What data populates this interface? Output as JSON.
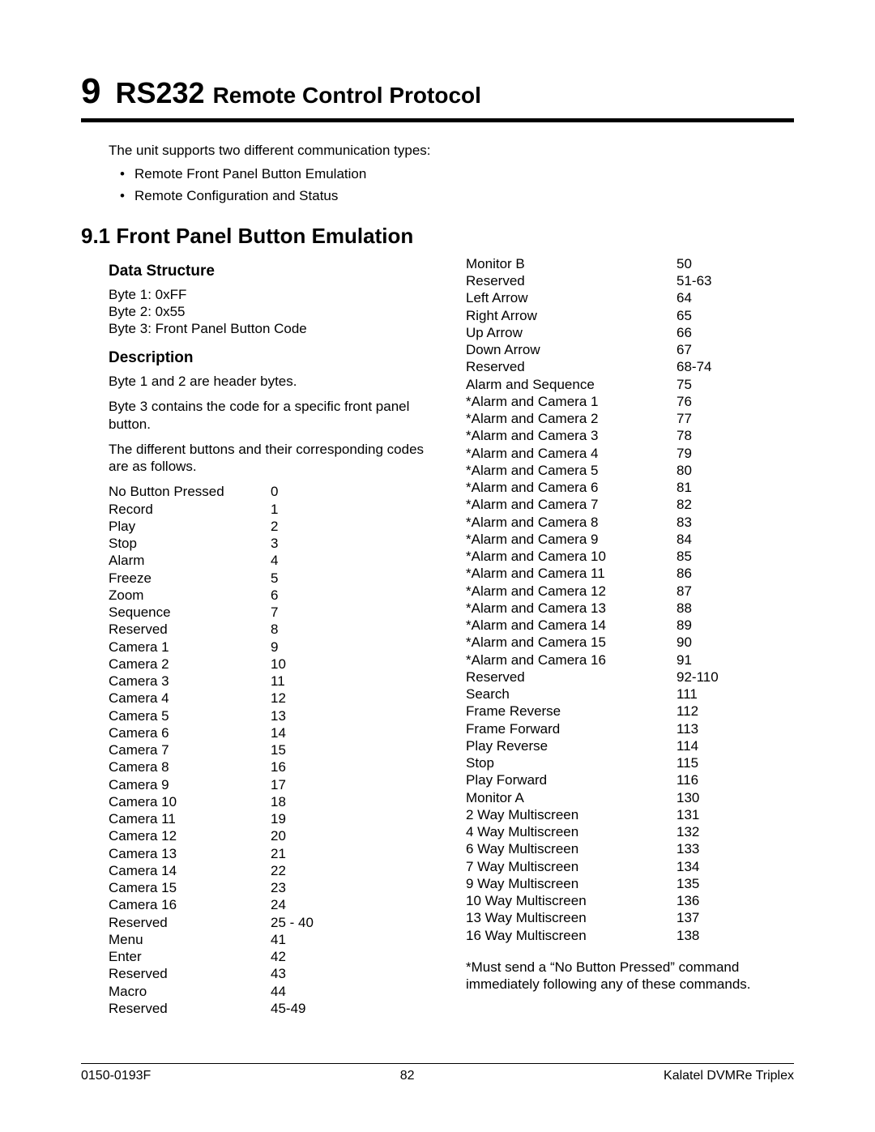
{
  "chapter": {
    "number": "9",
    "title_strong": "RS232",
    "title_rest": "Remote Control Protocol"
  },
  "intro": {
    "lead": "The unit supports two different communication types:",
    "bullets": [
      "Remote Front Panel Button Emulation",
      "Remote Configuration and Status"
    ]
  },
  "section": {
    "number_title": "9.1  Front Panel Button Emulation"
  },
  "left": {
    "data_structure_head": "Data Structure",
    "bytes": [
      "Byte 1:  0xFF",
      "Byte 2:  0x55",
      "Byte 3:  Front Panel Button Code"
    ],
    "description_head": "Description",
    "para1": "Byte 1 and 2 are header bytes.",
    "para2": "Byte 3 contains the code for a specific front panel button.",
    "para3": "The different buttons and their corresponding codes are as follows.",
    "codes": [
      {
        "label": "No Button Pressed",
        "val": "0"
      },
      {
        "label": "Record",
        "val": "1"
      },
      {
        "label": "Play",
        "val": "2"
      },
      {
        "label": "Stop",
        "val": "3"
      },
      {
        "label": "Alarm",
        "val": "4"
      },
      {
        "label": "Freeze",
        "val": "5"
      },
      {
        "label": "Zoom",
        "val": "6"
      },
      {
        "label": "Sequence",
        "val": "7"
      },
      {
        "label": "Reserved",
        "val": "8"
      },
      {
        "label": "Camera 1",
        "val": "9"
      },
      {
        "label": "Camera 2",
        "val": "10"
      },
      {
        "label": "Camera 3",
        "val": "11"
      },
      {
        "label": "Camera 4",
        "val": "12"
      },
      {
        "label": "Camera 5",
        "val": "13"
      },
      {
        "label": "Camera 6",
        "val": "14"
      },
      {
        "label": "Camera 7",
        "val": "15"
      },
      {
        "label": "Camera 8",
        "val": "16"
      },
      {
        "label": "Camera 9",
        "val": "17"
      },
      {
        "label": "Camera 10",
        "val": "18"
      },
      {
        "label": "Camera 11",
        "val": "19"
      },
      {
        "label": "Camera 12",
        "val": "20"
      },
      {
        "label": "Camera 13",
        "val": "21"
      },
      {
        "label": "Camera 14",
        "val": "22"
      },
      {
        "label": "Camera 15",
        "val": "23"
      },
      {
        "label": "Camera 16",
        "val": "24"
      },
      {
        "label": "Reserved",
        "val": "25 - 40"
      },
      {
        "label": "Menu",
        "val": "41"
      },
      {
        "label": "Enter",
        "val": "42"
      },
      {
        "label": "Reserved",
        "val": "43"
      },
      {
        "label": "Macro",
        "val": "44"
      },
      {
        "label": "Reserved",
        "val": "45-49"
      }
    ]
  },
  "right": {
    "codes": [
      {
        "label": "Monitor B",
        "val": "50"
      },
      {
        "label": "Reserved",
        "val": "51-63"
      },
      {
        "label": "Left Arrow",
        "val": "64"
      },
      {
        "label": "Right Arrow",
        "val": "65"
      },
      {
        "label": "Up Arrow",
        "val": "66"
      },
      {
        "label": "Down Arrow",
        "val": "67"
      },
      {
        "label": "Reserved",
        "val": "68-74"
      },
      {
        "label": "Alarm and Sequence",
        "val": "75"
      },
      {
        "label": "*Alarm and Camera 1",
        "val": "76"
      },
      {
        "label": "*Alarm and Camera 2",
        "val": "77"
      },
      {
        "label": "*Alarm and Camera 3",
        "val": "78"
      },
      {
        "label": "*Alarm and Camera 4",
        "val": "79"
      },
      {
        "label": "*Alarm and Camera 5",
        "val": "80"
      },
      {
        "label": "*Alarm and Camera 6",
        "val": "81"
      },
      {
        "label": "*Alarm and Camera 7",
        "val": "82"
      },
      {
        "label": "*Alarm and Camera 8",
        "val": "83"
      },
      {
        "label": "*Alarm and Camera 9",
        "val": "84"
      },
      {
        "label": "*Alarm and Camera 10",
        "val": "85"
      },
      {
        "label": "*Alarm and Camera 11",
        "val": "86"
      },
      {
        "label": "*Alarm and Camera 12",
        "val": "87"
      },
      {
        "label": "*Alarm and Camera 13",
        "val": "88"
      },
      {
        "label": "*Alarm and Camera 14",
        "val": "89"
      },
      {
        "label": "*Alarm and Camera 15",
        "val": "90"
      },
      {
        "label": "*Alarm and Camera 16",
        "val": "91"
      },
      {
        "label": "Reserved",
        "val": "92-110"
      },
      {
        "label": "Search",
        "val": "111"
      },
      {
        "label": "Frame Reverse",
        "val": "112"
      },
      {
        "label": "Frame Forward",
        "val": "113"
      },
      {
        "label": "Play Reverse",
        "val": "114"
      },
      {
        "label": "Stop",
        "val": "115"
      },
      {
        "label": "Play Forward",
        "val": "116"
      },
      {
        "label": "Monitor A",
        "val": "130"
      },
      {
        "label": "2 Way Multiscreen",
        "val": "131"
      },
      {
        "label": "4 Way Multiscreen",
        "val": "132"
      },
      {
        "label": "6 Way Multiscreen",
        "val": "133"
      },
      {
        "label": "7 Way Multiscreen",
        "val": "134"
      },
      {
        "label": "9 Way Multiscreen",
        "val": "135"
      },
      {
        "label": "10 Way Multiscreen",
        "val": "136"
      },
      {
        "label": "13 Way Multiscreen",
        "val": "137"
      },
      {
        "label": "16 Way Multiscreen",
        "val": "138"
      }
    ],
    "footnote": "*Must send a “No Button Pressed” command immediately following any of these commands."
  },
  "footer": {
    "left": "0150-0193F",
    "center": "82",
    "right": "Kalatel DVMRe Triplex"
  }
}
